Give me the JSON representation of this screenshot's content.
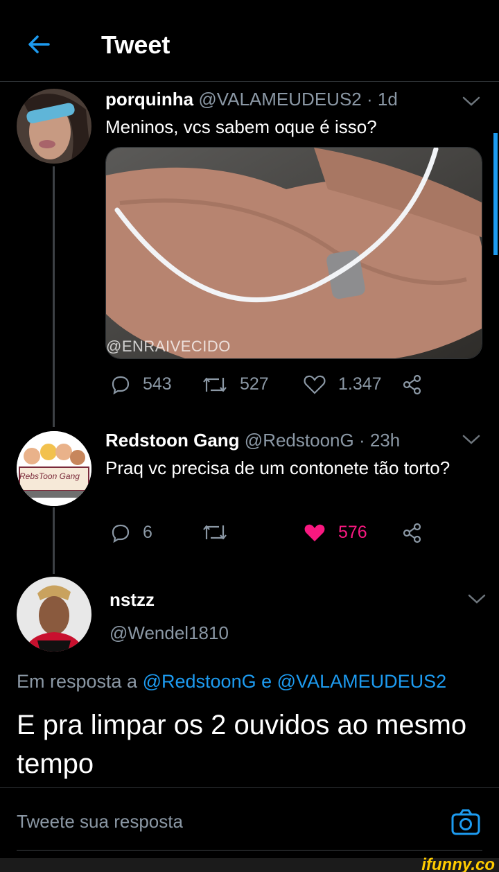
{
  "header": {
    "title": "Tweet"
  },
  "tweets": [
    {
      "name": "porquinha",
      "handle": "@VALAMEUDEUS2",
      "time": "· 1d",
      "text": "Meninos, vcs sabem oque é isso?",
      "media_watermark": "@ENRAIVECIDO",
      "replies": "543",
      "retweets": "527",
      "likes": "1.347"
    },
    {
      "name": "Redstoon Gang",
      "handle": "@RedstoonG",
      "time": "· 23h",
      "text": "Praq vc precisa de um contonete tão torto?",
      "replies": "6",
      "likes": "576",
      "avatar_logo_text": "RebsToon Gang"
    }
  ],
  "main_tweet": {
    "name": "nstzz",
    "handle": "@Wendel1810",
    "reply_prefix": "Em resposta a",
    "reply_to_1": "@RedstoonG",
    "reply_joiner": "e",
    "reply_to_2": "@VALAMEUDEUS2",
    "text": "E pra limpar os 2 ouvidos ao mesmo tempo"
  },
  "reply_box": {
    "placeholder": "Tweete sua resposta"
  },
  "watermark_site": "ifunny.co",
  "colors": {
    "accent": "#1d9bf0",
    "like": "#f91880",
    "secondary": "#8b98a5",
    "background": "#000000"
  },
  "icons": [
    "back-arrow-icon",
    "chevron-down-icon",
    "reply-icon",
    "retweet-icon",
    "heart-icon",
    "share-icon",
    "camera-icon"
  ]
}
